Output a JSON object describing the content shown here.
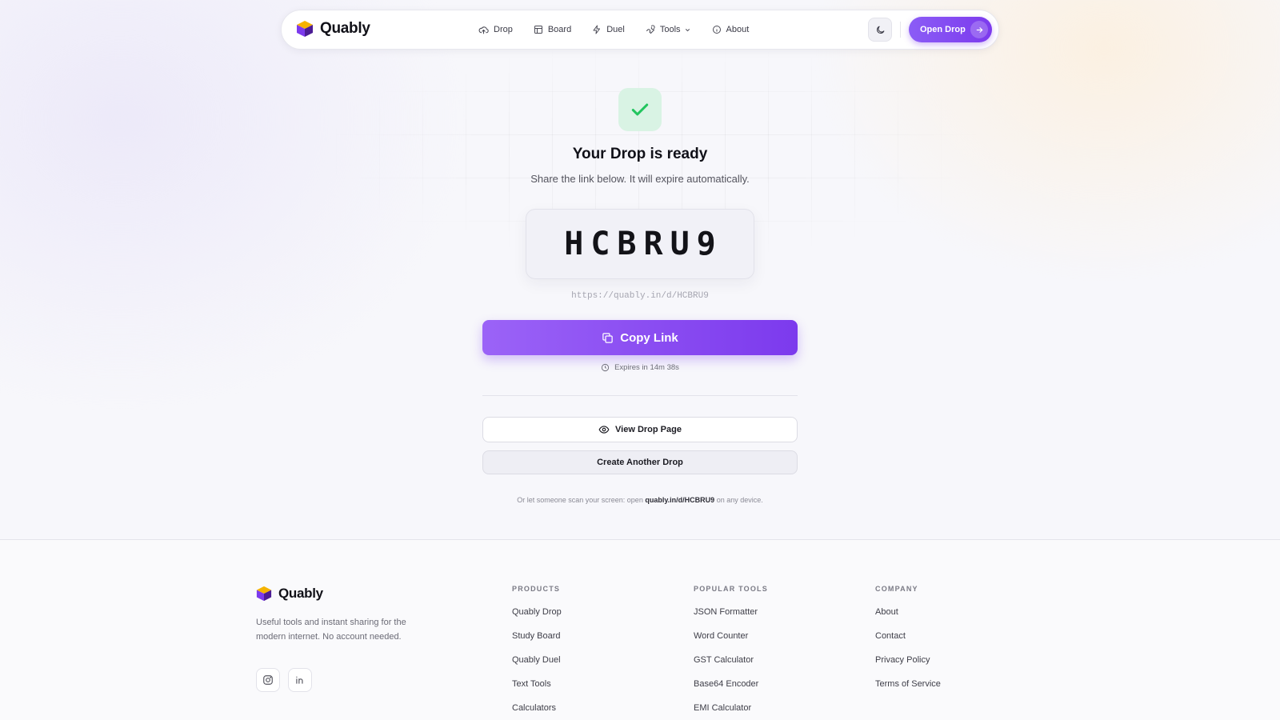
{
  "nav": {
    "brand": "Quably",
    "links": [
      {
        "label": "Drop",
        "icon": "cloud-upload-icon"
      },
      {
        "label": "Board",
        "icon": "board-icon"
      },
      {
        "label": "Duel",
        "icon": "lightning-icon"
      },
      {
        "label": "Tools",
        "icon": "wrench-icon"
      },
      {
        "label": "About",
        "icon": "info-icon"
      }
    ],
    "theme_icon": "moon-icon",
    "cta_label": "Open Drop"
  },
  "main": {
    "title": "Your Drop is ready",
    "subtitle": "Share the link below. It will expire automatically.",
    "code": "HCBRU9",
    "url": "https://quably.in/d/HCBRU9",
    "copy_label": "Copy Link",
    "expires": "Expires in 14m 38s",
    "view_label": "View Drop Page",
    "another_label": "Create Another Drop",
    "scan_prefix": "Or let someone scan your screen: open",
    "scan_link": "quably.in/d/HCBRU9",
    "scan_suffix": "on any device."
  },
  "footer": {
    "brand": "Quably",
    "description": "Useful tools and instant sharing for the modern internet. No account needed.",
    "columns": [
      {
        "heading": "PRODUCTS",
        "items": [
          "Quably Drop",
          "Study Board",
          "Quably Duel",
          "Text Tools",
          "Calculators"
        ]
      },
      {
        "heading": "POPULAR TOOLS",
        "items": [
          "JSON Formatter",
          "Word Counter",
          "GST Calculator",
          "Base64 Encoder",
          "EMI Calculator"
        ]
      },
      {
        "heading": "COMPANY",
        "items": [
          "About",
          "Contact",
          "Privacy Policy",
          "Terms of Service"
        ]
      }
    ],
    "socials": [
      "instagram-icon",
      "linkedin-icon"
    ]
  },
  "colors": {
    "accent": "#7c3aed",
    "accent_light": "#9b63f7",
    "success_bg": "#d9f3e4",
    "success": "#22c55e",
    "background": "#f7f7fb"
  }
}
